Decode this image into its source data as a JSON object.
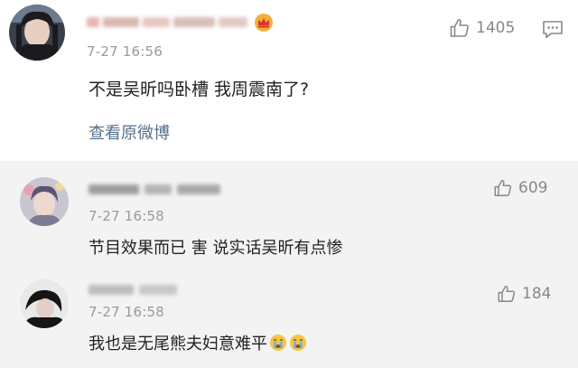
{
  "main_comment": {
    "time": "7-27 16:56",
    "text": "不是吴昕吗卧槽 我周震南了?",
    "view_original": "查看原微博",
    "likes": "1405"
  },
  "replies": [
    {
      "time": "7-27 16:58",
      "text": "节目效果而已 害 说实话吴昕有点惨",
      "likes": "609"
    },
    {
      "time": "7-27 16:58",
      "text": "我也是无尾熊夫妇意难平",
      "likes": "184"
    }
  ],
  "icons": {
    "like": "thumbs-up-icon",
    "reply": "comment-icon",
    "vip": "crown-badge-icon",
    "emoji": "crying-face-emoji"
  },
  "colors": {
    "link": "#56708f",
    "meta": "#9a9a9a",
    "reply_bg": "#f3f3f3",
    "vip_gold": "#f0b33a"
  }
}
